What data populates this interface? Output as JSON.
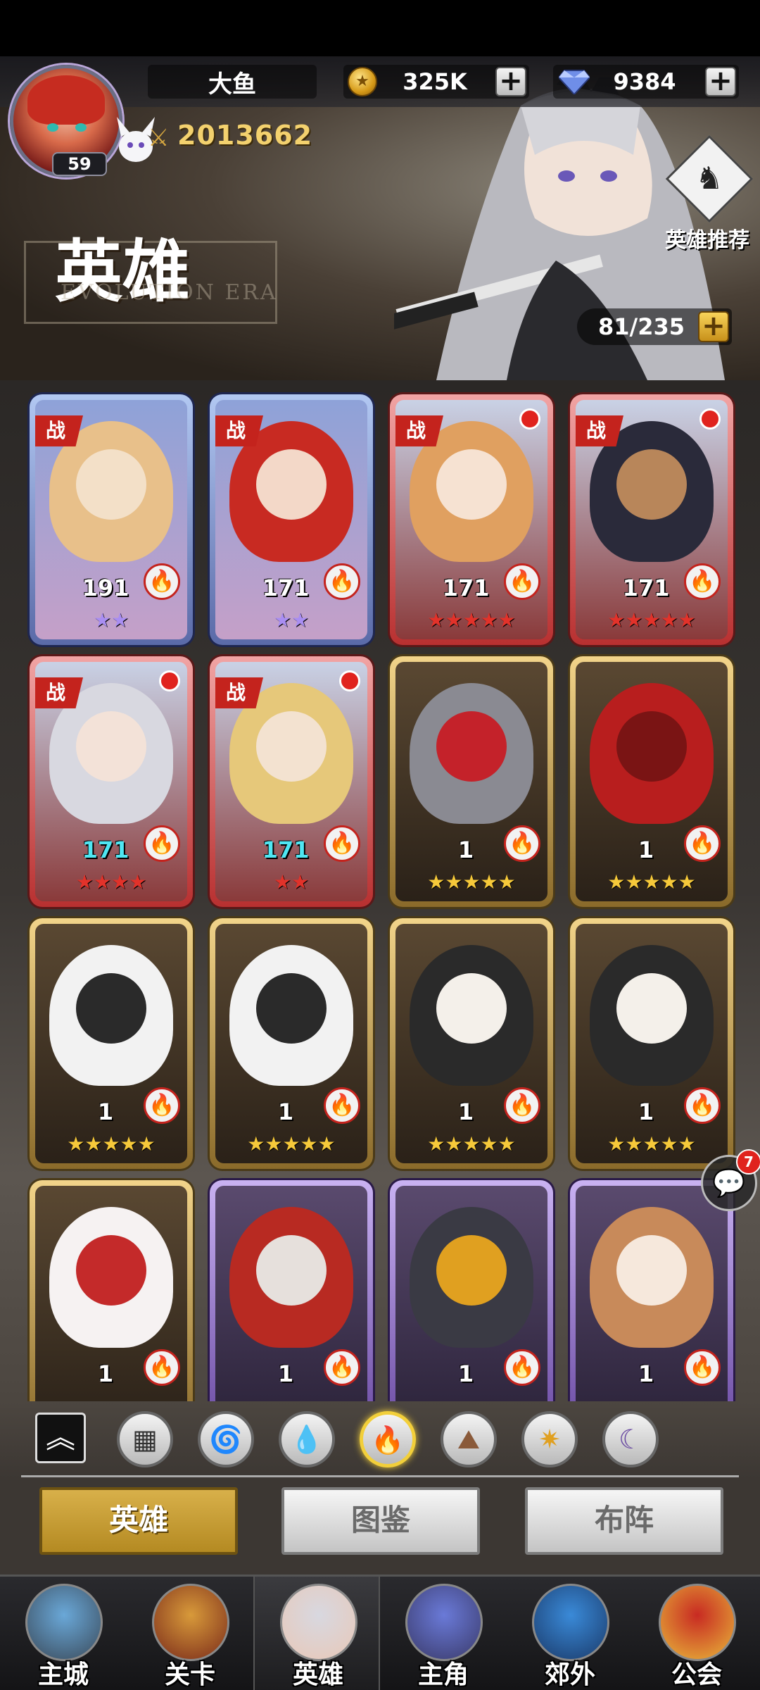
{
  "player": {
    "name": "大鱼",
    "level": "59",
    "power": "2013662"
  },
  "resources": {
    "gold": "325K",
    "gems": "9384"
  },
  "header": {
    "title": "英雄",
    "subtitle": "EVOLUTION ERA",
    "recommend_label": "英雄推荐",
    "capacity": "81/235"
  },
  "heroes": [
    {
      "tag": "战",
      "level": "191",
      "stars": "★★",
      "star_color": "purple",
      "frame": "blue",
      "dot": false,
      "level_color": "white"
    },
    {
      "tag": "战",
      "level": "171",
      "stars": "★★",
      "star_color": "purple",
      "frame": "blue",
      "dot": false,
      "level_color": "white"
    },
    {
      "tag": "战",
      "level": "171",
      "stars": "★★★★★",
      "star_color": "red",
      "frame": "red",
      "dot": true,
      "level_color": "white"
    },
    {
      "tag": "战",
      "level": "171",
      "stars": "★★★★★",
      "star_color": "red",
      "frame": "red",
      "dot": true,
      "level_color": "white"
    },
    {
      "tag": "战",
      "level": "171",
      "stars": "★★★★",
      "star_color": "red",
      "frame": "red",
      "dot": true,
      "level_color": "cyan"
    },
    {
      "tag": "战",
      "level": "171",
      "stars": "★★",
      "star_color": "red",
      "frame": "red",
      "dot": true,
      "level_color": "cyan"
    },
    {
      "tag": "",
      "level": "1",
      "stars": "★★★★★",
      "star_color": "gold",
      "frame": "gold",
      "dot": false,
      "level_color": "white"
    },
    {
      "tag": "",
      "level": "1",
      "stars": "★★★★★",
      "star_color": "gold",
      "frame": "gold",
      "dot": false,
      "level_color": "white"
    },
    {
      "tag": "",
      "level": "1",
      "stars": "★★★★★",
      "star_color": "gold",
      "frame": "gold",
      "dot": false,
      "level_color": "white"
    },
    {
      "tag": "",
      "level": "1",
      "stars": "★★★★★",
      "star_color": "gold",
      "frame": "gold",
      "dot": false,
      "level_color": "white"
    },
    {
      "tag": "",
      "level": "1",
      "stars": "★★★★★",
      "star_color": "gold",
      "frame": "gold",
      "dot": false,
      "level_color": "white"
    },
    {
      "tag": "",
      "level": "1",
      "stars": "★★★★★",
      "star_color": "gold",
      "frame": "gold",
      "dot": false,
      "level_color": "white"
    },
    {
      "tag": "",
      "level": "1",
      "stars": "",
      "star_color": "gold",
      "frame": "gold",
      "dot": false,
      "level_color": "white"
    },
    {
      "tag": "",
      "level": "1",
      "stars": "",
      "star_color": "gold",
      "frame": "purple",
      "dot": false,
      "level_color": "white"
    },
    {
      "tag": "",
      "level": "1",
      "stars": "",
      "star_color": "gold",
      "frame": "purple",
      "dot": false,
      "level_color": "white"
    },
    {
      "tag": "",
      "level": "1",
      "stars": "",
      "star_color": "gold",
      "frame": "purple",
      "dot": false,
      "level_color": "white"
    }
  ],
  "chat": {
    "count": "7"
  },
  "filters": [
    {
      "icon": "all-icon",
      "glyph": "▦",
      "color": "#333333",
      "active": false
    },
    {
      "icon": "wind-icon",
      "glyph": "🌀",
      "color": "#2a9a5a",
      "active": false
    },
    {
      "icon": "water-icon",
      "glyph": "💧",
      "color": "#2a7ad6",
      "active": false
    },
    {
      "icon": "fire-icon",
      "glyph": "🔥",
      "color": "#d62a1e",
      "active": true
    },
    {
      "icon": "earth-icon",
      "glyph": "⛰",
      "color": "#8a5a3a",
      "active": false
    },
    {
      "icon": "light-icon",
      "glyph": "✷",
      "color": "#e0a020",
      "active": false
    },
    {
      "icon": "dark-icon",
      "glyph": "☾",
      "color": "#6a4aa2",
      "active": false
    }
  ],
  "tabs": [
    {
      "label": "英雄",
      "active": true
    },
    {
      "label": "图鉴",
      "active": false
    },
    {
      "label": "布阵",
      "active": false
    }
  ],
  "nav": [
    {
      "label": "主城",
      "icon": "city-icon",
      "active": false
    },
    {
      "label": "关卡",
      "icon": "stage-icon",
      "active": false
    },
    {
      "label": "英雄",
      "icon": "hero-icon",
      "active": true
    },
    {
      "label": "主角",
      "icon": "protagonist-icon",
      "active": false
    },
    {
      "label": "郊外",
      "icon": "outskirts-icon",
      "active": false
    },
    {
      "label": "公会",
      "icon": "guild-icon",
      "active": false
    }
  ]
}
